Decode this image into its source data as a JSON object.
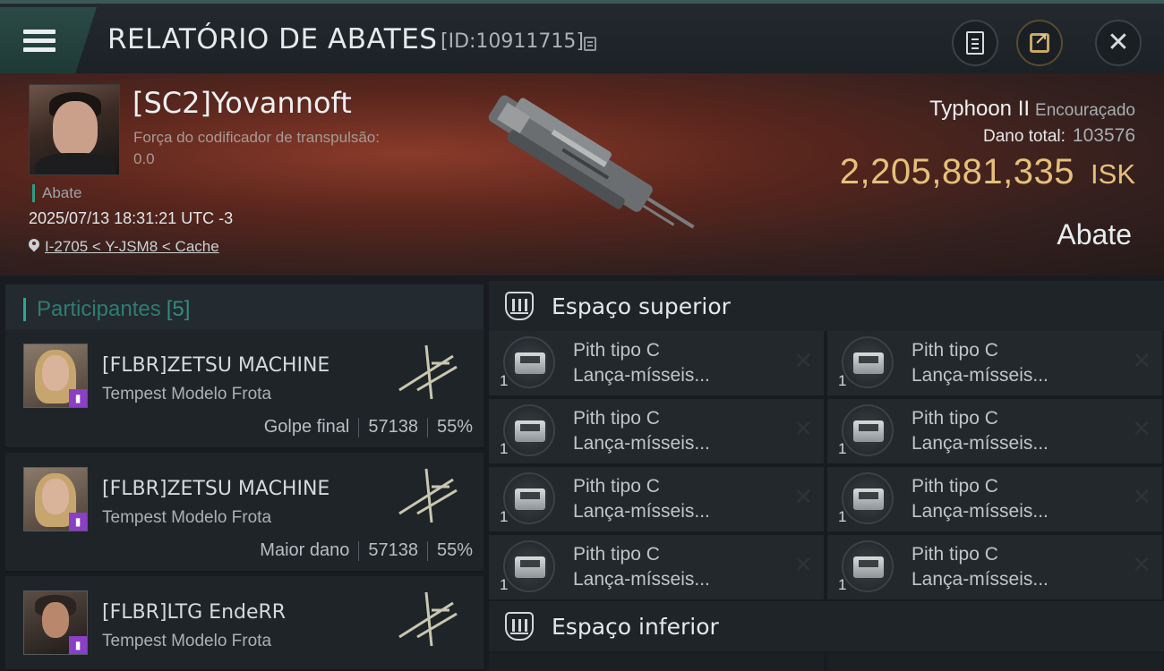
{
  "header": {
    "title": "RELATÓRIO DE ABATES",
    "report_id": "[ID:10911715]"
  },
  "victim": {
    "name": "[SC2]Yovannoft",
    "tw_label": "Força do codificador de transpulsão:",
    "tw_value": "0.0",
    "tag": "Abate",
    "timestamp": "2025/07/13 18:31:21 UTC -3",
    "location": "I-2705 < Y-JSM8 < Cache",
    "ship_name": "Typhoon II",
    "ship_class": "Encouraçado",
    "damage_label": "Dano total:",
    "damage_total": "103576",
    "isk_value": "2,205,881,335",
    "isk_unit": "ISK",
    "result": "Abate"
  },
  "participants": {
    "label": "Participantes",
    "count": "[5]",
    "items": [
      {
        "name": "[FLBR]ZETSU MACHINE",
        "ship": "Tempest Modelo Frota",
        "role": "Golpe final",
        "damage": "57138",
        "percent": "55%"
      },
      {
        "name": "[FLBR]ZETSU MACHINE",
        "ship": "Tempest Modelo Frota",
        "role": "Maior dano",
        "damage": "57138",
        "percent": "55%"
      },
      {
        "name": "[FLBR]LTG EndeRR",
        "ship": "Tempest Modelo Frota",
        "role": "",
        "damage": "",
        "percent": ""
      }
    ]
  },
  "sections": {
    "upper_title": "Espaço superior",
    "lower_title": "Espaço inferior",
    "upper_slots": [
      {
        "name": "Pith tipo C",
        "sub": "Lança-mísseis...",
        "qty": "1"
      },
      {
        "name": "Pith tipo C",
        "sub": "Lança-mísseis...",
        "qty": "1"
      },
      {
        "name": "Pith tipo C",
        "sub": "Lança-mísseis...",
        "qty": "1"
      },
      {
        "name": "Pith tipo C",
        "sub": "Lança-mísseis...",
        "qty": "1"
      },
      {
        "name": "Pith tipo C",
        "sub": "Lança-mísseis...",
        "qty": "1"
      },
      {
        "name": "Pith tipo C",
        "sub": "Lança-mísseis...",
        "qty": "1"
      },
      {
        "name": "Pith tipo C",
        "sub": "Lança-mísseis...",
        "qty": "1"
      },
      {
        "name": "Pith tipo C",
        "sub": "Lança-mísseis...",
        "qty": "1"
      }
    ]
  },
  "icons": {
    "menu": "menu-icon",
    "copy": "copy-icon",
    "clipboard": "clipboard-icon",
    "share": "share-icon",
    "close": "close-icon",
    "location": "pin-icon",
    "slot": "shield-slot-icon",
    "remove": "x-icon"
  },
  "colors": {
    "accent": "#2aa796",
    "isk": "#e6c07a"
  }
}
